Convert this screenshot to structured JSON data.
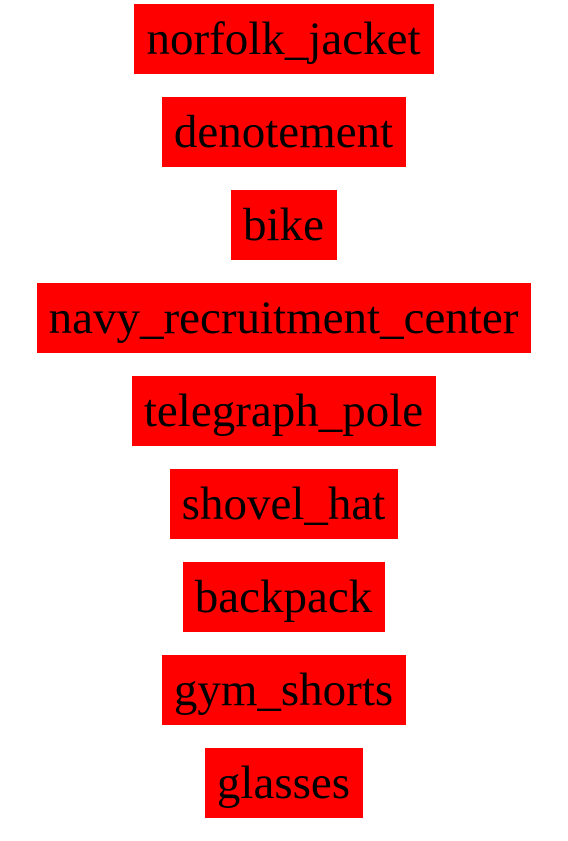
{
  "colors": {
    "label_background": "#ff0000",
    "label_text": "#000000",
    "page_background": "#ffffff"
  },
  "labels": [
    "norfolk_jacket",
    "denotement",
    "bike",
    "navy_recruitment_center",
    "telegraph_pole",
    "shovel_hat",
    "backpack",
    "gym_shorts",
    "glasses"
  ]
}
